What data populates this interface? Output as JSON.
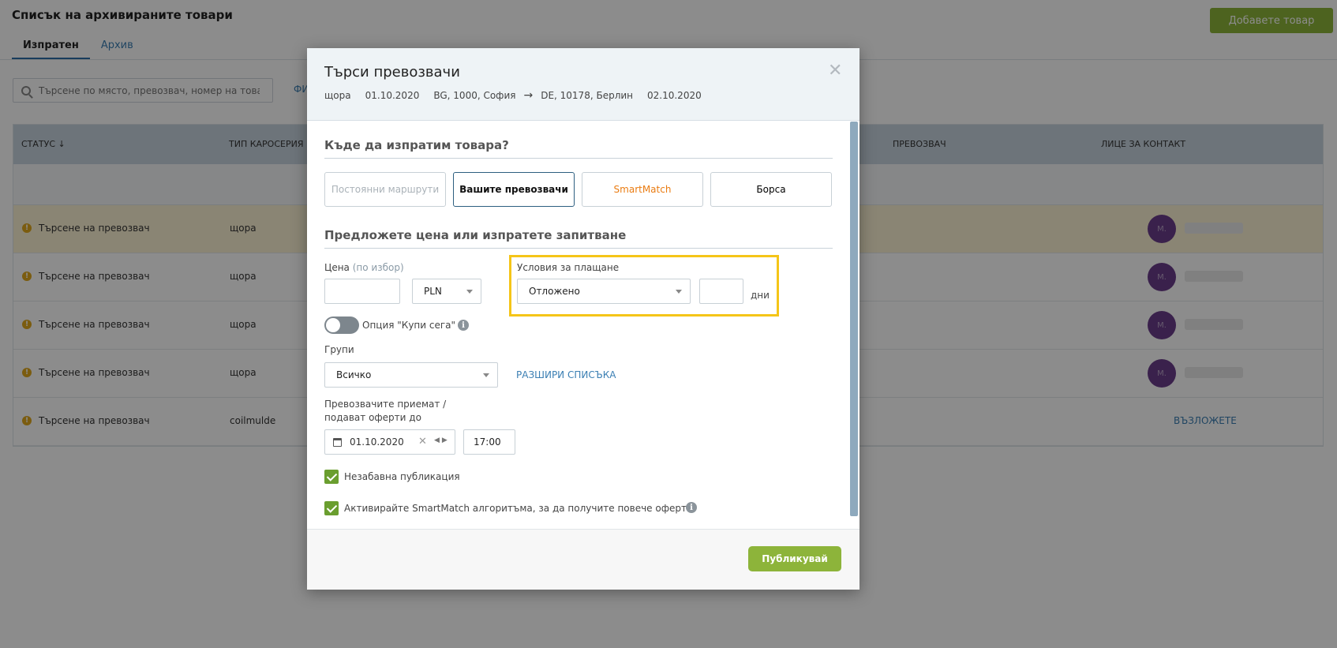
{
  "page": {
    "title": "Списък на архивираните товари",
    "add_button": "Добавете товар",
    "tabs": [
      {
        "label": "Изпратен",
        "active": true
      },
      {
        "label": "Архив",
        "active": false
      }
    ],
    "search_placeholder": "Търсене по място, превозвач, номер на товар...",
    "filter_label": "ФИ",
    "table": {
      "headers": {
        "status": "СТАТУС",
        "body_type": "ТИП КАРОСЕРИЯ",
        "carrier": "ПРЕВОЗВАЧ",
        "contact": "ЛИЦЕ ЗА КОНТАКТ"
      },
      "rows": [
        {
          "status": "Търсене на превозвач",
          "body": "щора",
          "contact": "avatar"
        },
        {
          "status": "Търсене на превозвач",
          "body": "щора",
          "contact": "avatar"
        },
        {
          "status": "Търсене на превозвач",
          "body": "щора",
          "contact": "avatar"
        },
        {
          "status": "Търсене на превозвач",
          "body": "щора",
          "contact": "avatar"
        },
        {
          "status": "Търсене на превозвач",
          "body": "coilmulde",
          "contact": "assign",
          "assign_label": "ВЪЗЛОЖЕТЕ"
        }
      ]
    }
  },
  "modal": {
    "title": "Търси превозвачи",
    "route": {
      "body": "щора",
      "date_from": "01.10.2020",
      "from": "BG, 1000, София",
      "to": "DE, 10178, Берлин",
      "date_to": "02.10.2020"
    },
    "section_where": "Къде да изпратим товара?",
    "dest_options": [
      "Постоянни маршрути",
      "Вашите превозвачи",
      "SmartMatch",
      "Борса"
    ],
    "section_price": "Предложете цена или изпратете запитване",
    "price_label": "Цена",
    "price_optional": "(по избор)",
    "price_value": "",
    "currency": "PLN",
    "payment_label": "Условия за плащане",
    "payment_value": "Отложено",
    "payment_days": "",
    "days_label": "дни",
    "buy_now_label": "Опция \"Купи сега\"",
    "groups_label": "Групи",
    "groups_value": "Всичко",
    "expand_link": "РАЗШИРИ СПИСЪКА",
    "deadline_label": "Превозвачите приемат / подават оферти до",
    "deadline_date": "01.10.2020",
    "deadline_time": "17:00",
    "immediate_label": "Незабавна публикация",
    "smartmatch_label": "Активирайте SmartMatch алгоритъма, за да получите повече оферти.",
    "publish_button": "Публикувай"
  },
  "colors": {
    "accent_green": "#8db43a",
    "highlight_yellow": "#f5c518",
    "smartmatch_orange": "#ea7c12",
    "link_blue": "#3b7fb3"
  }
}
